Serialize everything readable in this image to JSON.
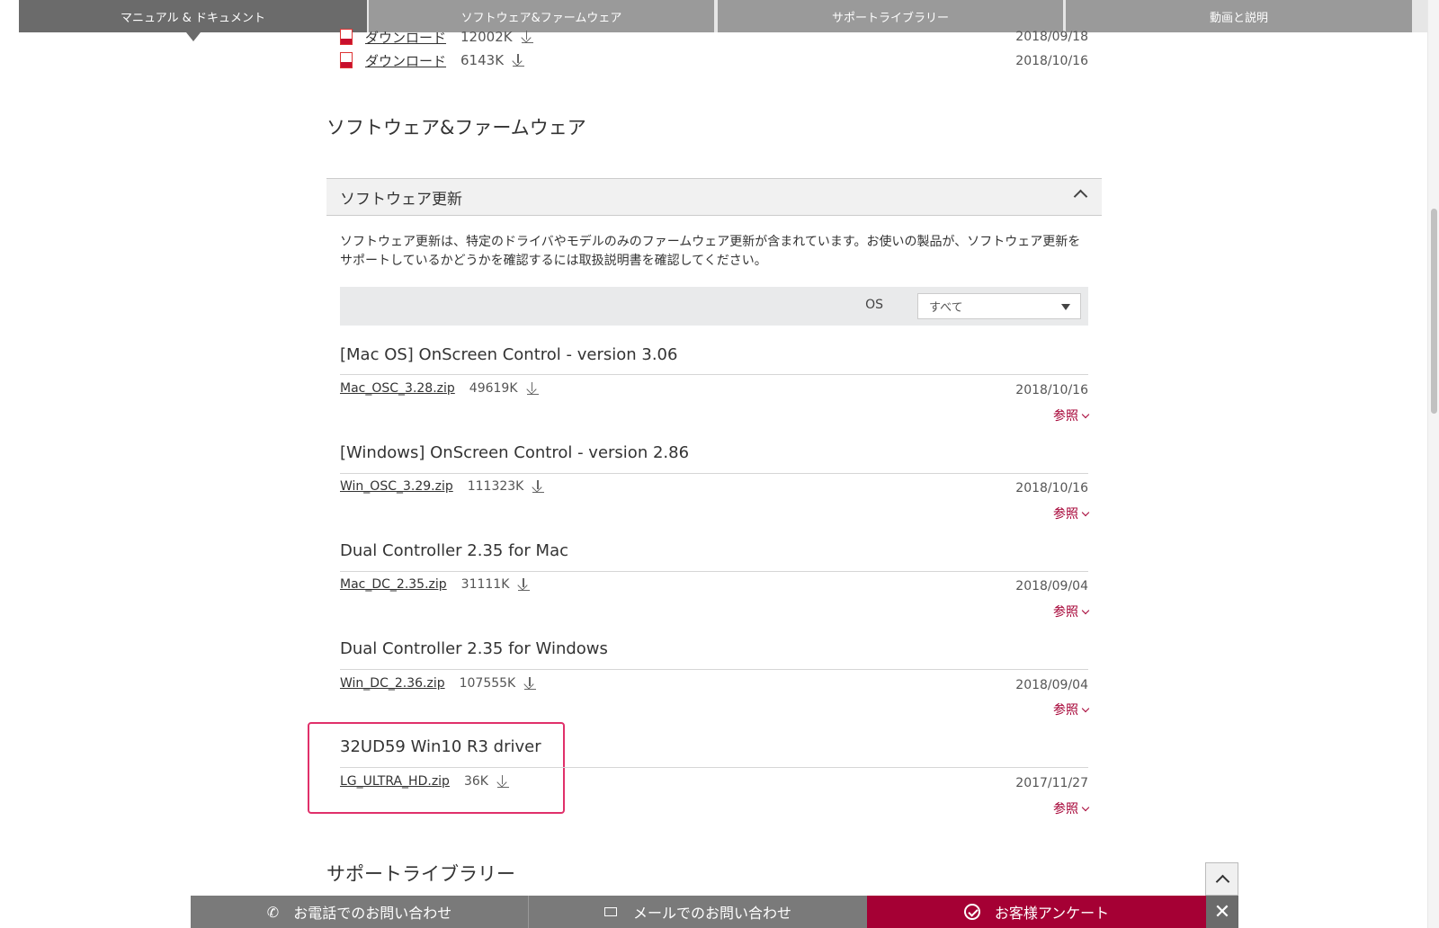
{
  "top_nav": {
    "tabs": [
      {
        "label": "マニュアル & ドキュメント",
        "active": true
      },
      {
        "label": "ソフトウェア&ファームウェア",
        "active": false
      },
      {
        "label": "サポートライブラリー",
        "active": false
      },
      {
        "label": "動画と説明",
        "active": false
      }
    ]
  },
  "documents": [
    {
      "link": "ダウンロード",
      "size": "12002K",
      "date": "2018/09/18"
    },
    {
      "link": "ダウンロード",
      "size": "6143K",
      "date": "2018/10/16"
    }
  ],
  "software_section": {
    "title": "ソフトウェア&ファームウェア",
    "accordion_title": "ソフトウェア更新",
    "description": "ソフトウェア更新は、特定のドライバやモデルのみのファームウェア更新が含まれています。お使いの製品が、ソフトウェア更新をサポートしているかどうかを確認するには取扱説明書を確認してください。",
    "os_label": "OS",
    "os_select_value": "すべて",
    "items": [
      {
        "title": "[Mac OS] OnScreen Control - version 3.06",
        "file": "Mac_OSC_3.28.zip",
        "size": "49619K",
        "date": "2018/10/16",
        "ref": "参照"
      },
      {
        "title": "[Windows] OnScreen Control - version 2.86",
        "file": "Win_OSC_3.29.zip",
        "size": "111323K",
        "date": "2018/10/16",
        "ref": "参照"
      },
      {
        "title": "Dual Controller 2.35 for Mac",
        "file": "Mac_DC_2.35.zip",
        "size": "31111K",
        "date": "2018/09/04",
        "ref": "参照"
      },
      {
        "title": "Dual Controller 2.35 for Windows",
        "file": "Win_DC_2.36.zip",
        "size": "107555K",
        "date": "2018/09/04",
        "ref": "参照"
      },
      {
        "title": "32UD59 Win10 R3 driver",
        "file": "LG_ULTRA_HD.zip",
        "size": "36K",
        "date": "2017/11/27",
        "ref": "参照"
      }
    ]
  },
  "support_library_title": "サポートライブラリー",
  "bottom_bar": {
    "phone": "お電話でのお問い合わせ",
    "mail": "メールでのお問い合わせ",
    "survey": "お客様アンケート",
    "close": "✕"
  },
  "colors": {
    "accent": "#a50034",
    "highlight_border": "#e0306a",
    "nav_active": "#6b6b6b",
    "nav_inactive": "#9a9a9a"
  }
}
